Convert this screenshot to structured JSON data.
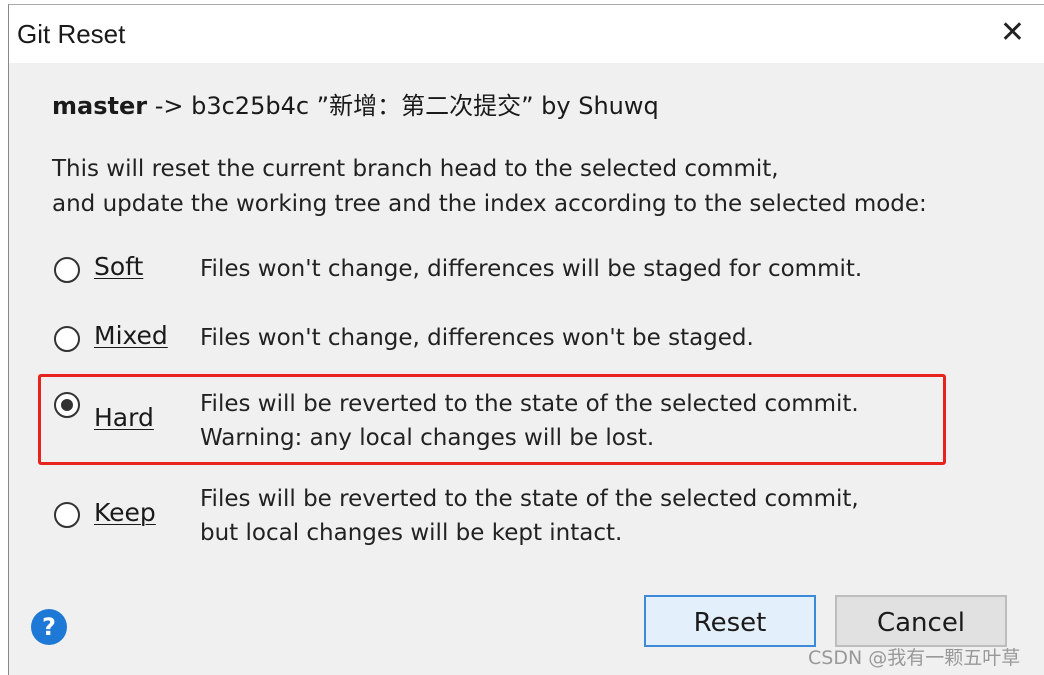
{
  "window": {
    "title": "Git Reset",
    "close_icon": "close-icon"
  },
  "header": {
    "branch": "master",
    "arrow": " -> ",
    "commit": "b3c25b4c",
    "message": " ”新增：第二次提交” by Shuwq"
  },
  "description": [
    "This will reset the current branch head to the selected commit,",
    "and update the working tree and the index according to the selected mode:"
  ],
  "options": [
    {
      "label": "Soft",
      "lines": [
        "Files won't change, differences will be staged for commit."
      ],
      "selected": false
    },
    {
      "label": "Mixed",
      "lines": [
        "Files won't change, differences won't be staged."
      ],
      "selected": false
    },
    {
      "label": "Hard",
      "lines": [
        "Files will be reverted to the state of the selected commit.",
        "Warning: any local changes will be lost."
      ],
      "selected": true
    },
    {
      "label": "Keep",
      "lines": [
        "Files will be reverted to the state of the selected commit,",
        "but local changes will be kept intact."
      ],
      "selected": false
    }
  ],
  "highlight_color": "#e8231d",
  "help": "?",
  "buttons": {
    "reset": "Reset",
    "cancel": "Cancel"
  },
  "watermark": "CSDN @我有一颗五叶草"
}
